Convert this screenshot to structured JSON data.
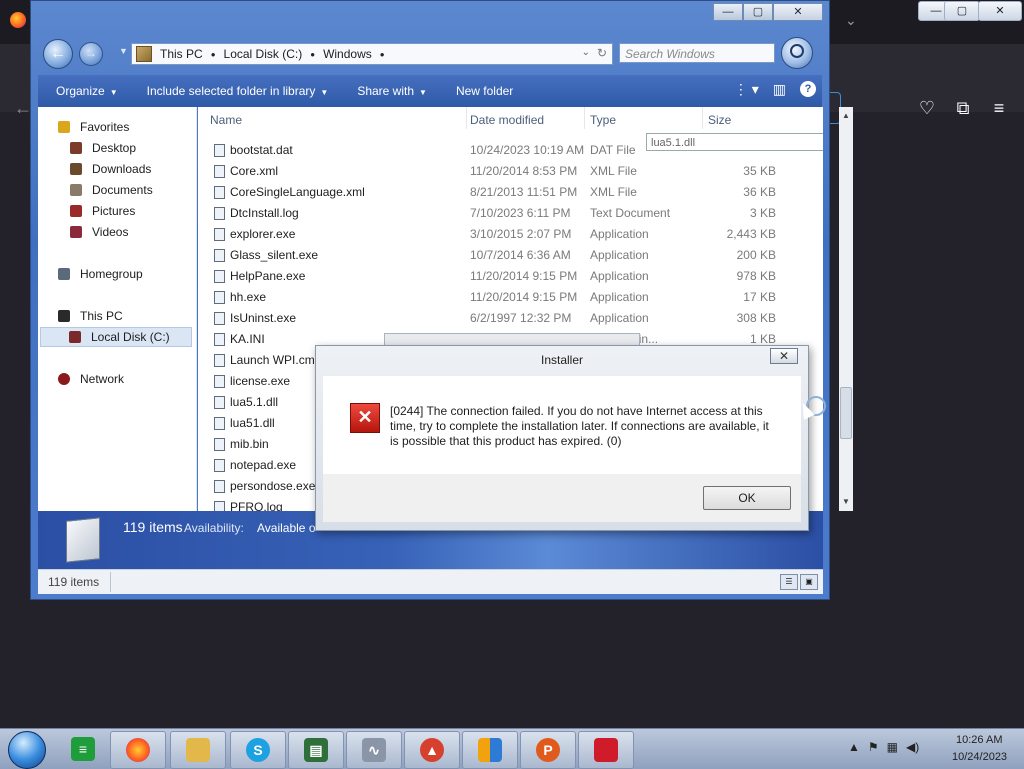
{
  "explorer": {
    "caption_buttons": {
      "minimize": "—",
      "maximize": "▢",
      "close": "✕"
    },
    "breadcrumb": [
      "This PC",
      "Local Disk (C:)",
      "Windows"
    ],
    "search_placeholder": "Search Windows",
    "toolbar": {
      "organize": "Organize",
      "include_library": "Include selected folder in library",
      "share_with": "Share with",
      "new_folder": "New folder"
    },
    "nav": {
      "favorites": "Favorites",
      "desktop": "Desktop",
      "downloads": "Downloads",
      "documents": "Documents",
      "pictures": "Pictures",
      "videos": "Videos",
      "homegroup": "Homegroup",
      "this_pc": "This PC",
      "local_disk": "Local Disk (C:)",
      "network": "Network"
    },
    "columns": {
      "name": "Name",
      "date": "Date modified",
      "type": "Type",
      "size": "Size"
    },
    "tooltip": "lua5.1.dll",
    "files": [
      {
        "name": "bootstat.dat",
        "date": "10/24/2023 10:19 AM",
        "type": "DAT File",
        "size": ""
      },
      {
        "name": "Core.xml",
        "date": "11/20/2014 8:53 PM",
        "type": "XML File",
        "size": "35 KB"
      },
      {
        "name": "CoreSingleLanguage.xml",
        "date": "8/21/2013 11:51 PM",
        "type": "XML File",
        "size": "36 KB"
      },
      {
        "name": "DtcInstall.log",
        "date": "7/10/2023 6:11 PM",
        "type": "Text Document",
        "size": "3 KB"
      },
      {
        "name": "explorer.exe",
        "date": "3/10/2015 2:07 PM",
        "type": "Application",
        "size": "2,443 KB"
      },
      {
        "name": "Glass_silent.exe",
        "date": "10/7/2014 6:36 AM",
        "type": "Application",
        "size": "200 KB"
      },
      {
        "name": "HelpPane.exe",
        "date": "11/20/2014 9:15 PM",
        "type": "Application",
        "size": "978 KB"
      },
      {
        "name": "hh.exe",
        "date": "11/20/2014 9:15 PM",
        "type": "Application",
        "size": "17 KB"
      },
      {
        "name": "IsUninst.exe",
        "date": "6/2/1997 12:32 PM",
        "type": "Application",
        "size": "308 KB"
      },
      {
        "name": "KA.INI",
        "date": "",
        "type": "ation settin...",
        "size": "1 KB"
      },
      {
        "name": "Launch WPI.cmd",
        "date": "",
        "type": "",
        "size": ""
      },
      {
        "name": "license.exe",
        "date": "",
        "type": "",
        "size": ""
      },
      {
        "name": "lua5.1.dll",
        "date": "",
        "type": "",
        "size": ""
      },
      {
        "name": "lua51.dll",
        "date": "",
        "type": "",
        "size": ""
      },
      {
        "name": "mib.bin",
        "date": "",
        "type": "",
        "size": ""
      },
      {
        "name": "notepad.exe",
        "date": "",
        "type": "",
        "size": ""
      },
      {
        "name": "persondose.exe",
        "date": "",
        "type": "",
        "size": ""
      },
      {
        "name": "PFRO.log",
        "date": "",
        "type": "",
        "size": ""
      }
    ],
    "details": {
      "count": "119 items",
      "avail_label": "Availability:",
      "avail_value": "Available o"
    },
    "status_count": "119 items"
  },
  "dialog": {
    "title": "Installer",
    "close": "✕",
    "message": "[0244] The connection failed. If you do not have Internet access at this time, try to complete the installation later. If connections are available, it is possible that this product has expired. (0)",
    "ok": "OK"
  },
  "taskbar": {
    "time": "10:26 AM",
    "date": "10/24/2023"
  }
}
